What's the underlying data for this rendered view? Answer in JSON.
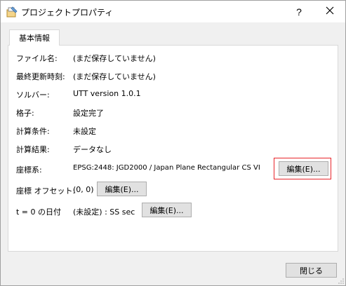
{
  "window": {
    "title": "プロジェクトプロパティ",
    "help_label": "?"
  },
  "tabs": [
    {
      "label": "基本情報"
    }
  ],
  "properties": {
    "file_name": {
      "label": "ファイル名:",
      "value": "(まだ保存していません)"
    },
    "last_updated": {
      "label": "最終更新時刻:",
      "value": "(まだ保存していません)"
    },
    "solver": {
      "label": "ソルバー:",
      "value": "UTT version 1.0.1"
    },
    "grid": {
      "label": "格子:",
      "value": "設定完了"
    },
    "calc_conditions": {
      "label": "計算条件:",
      "value": "未設定"
    },
    "calc_results": {
      "label": "計算結果:",
      "value": "データなし"
    },
    "coordinate_system": {
      "label": "座標系:",
      "value": "EPSG:2448: JGD2000 / Japan Plane Rectangular CS VI",
      "button_label": "編集(E)..."
    },
    "coordinate_offset": {
      "label": "座標 オフセット:",
      "value": "(0, 0)",
      "button_label": "編集(E)..."
    },
    "t0_date": {
      "label": "t = 0 の日付",
      "value": "(未設定) : SS sec",
      "button_label": "編集(E)..."
    }
  },
  "footer": {
    "close_label": "閉じる"
  },
  "colors": {
    "highlight": "#e8242a",
    "window_bg": "#f0f0f0",
    "panel_bg": "#ffffff"
  }
}
